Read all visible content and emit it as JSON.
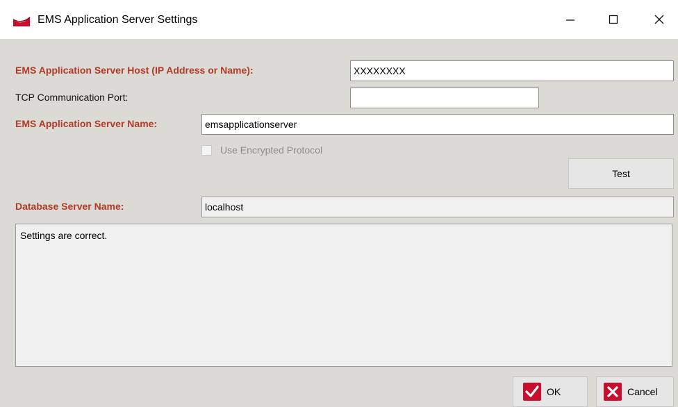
{
  "window": {
    "title": "EMS Application Server Settings",
    "minimize_glyph": "—",
    "maximize_glyph": "☐",
    "close_glyph": "✕"
  },
  "form": {
    "host_label": "EMS Application Server Host (IP Address or Name):",
    "host_value": "XXXXXXXX",
    "port_label": "TCP Communication Port:",
    "port_value": "",
    "server_name_label": "EMS Application Server Name:",
    "server_name_value": "emsapplicationserver",
    "encrypted_label": "Use Encrypted Protocol",
    "encrypted_checked": false,
    "test_button": "Test",
    "db_server_label": "Database Server Name:",
    "db_server_value": "localhost",
    "message": "Settings are correct."
  },
  "buttons": {
    "ok_label": "OK",
    "cancel_label": "Cancel"
  },
  "colors": {
    "required_label": "#b23a26",
    "dialog_background": "#dcdad5",
    "ok_icon": "#c8102e",
    "cancel_icon": "#c8102e"
  },
  "icons": {
    "app": "ems-logo-icon",
    "ok": "checkmark-icon",
    "cancel": "x-mark-icon"
  }
}
